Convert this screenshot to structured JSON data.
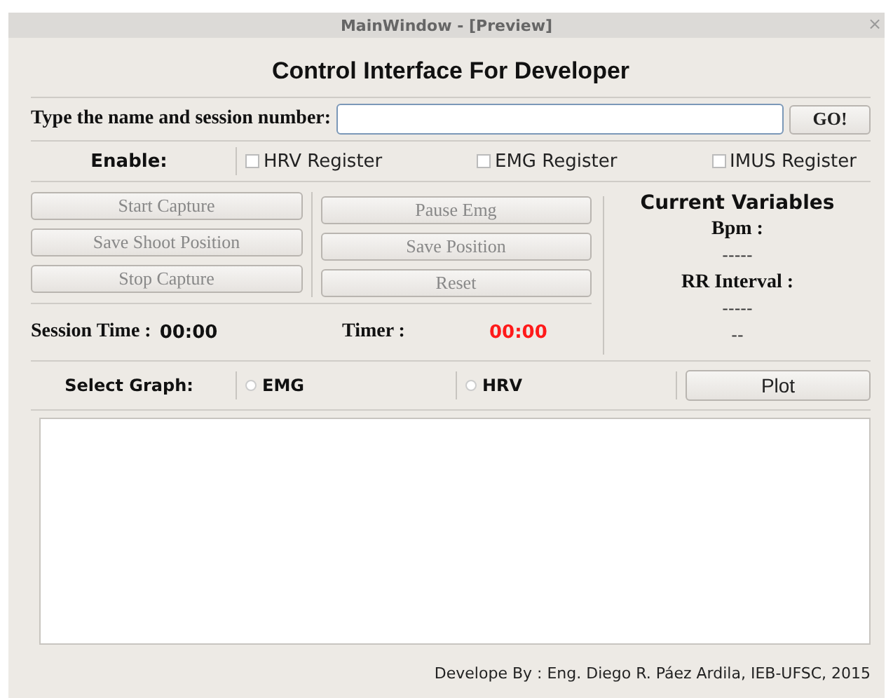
{
  "window": {
    "title": "MainWindow - [Preview]",
    "close": "×"
  },
  "heading": "Control Interface For Developer",
  "session_input": {
    "label": "Type the name and session number:",
    "button": "GO!"
  },
  "enable": {
    "label": "Enable:",
    "options": [
      {
        "label": "HRV Register",
        "checked": false
      },
      {
        "label": "EMG Register",
        "checked": false
      },
      {
        "label": "IMUS Register",
        "checked": false
      }
    ]
  },
  "buttons_left": [
    {
      "label": "Start Capture",
      "disabled": true
    },
    {
      "label": "Save Shoot Position",
      "disabled": true
    },
    {
      "label": "Stop Capture",
      "disabled": true
    }
  ],
  "buttons_right": [
    {
      "label": "Pause Emg",
      "disabled": true
    },
    {
      "label": "Save Position",
      "disabled": true
    },
    {
      "label": "Reset",
      "disabled": true
    }
  ],
  "session_time": {
    "label": "Session Time :",
    "value": "00:00"
  },
  "timer": {
    "label": "Timer :",
    "value": "00:00"
  },
  "current_variables": {
    "title": "Current Variables",
    "items": [
      {
        "label": "Bpm :",
        "value": "-----"
      },
      {
        "label": "RR Interval :",
        "value": "-----"
      }
    ],
    "extra": "--"
  },
  "select_graph": {
    "label": "Select Graph:",
    "options": [
      {
        "label": "EMG",
        "selected": false
      },
      {
        "label": "HRV",
        "selected": false
      }
    ],
    "button": "Plot"
  },
  "footer": "Develope By : Eng. Diego R. Páez Ardila, IEB-UFSC, 2015"
}
